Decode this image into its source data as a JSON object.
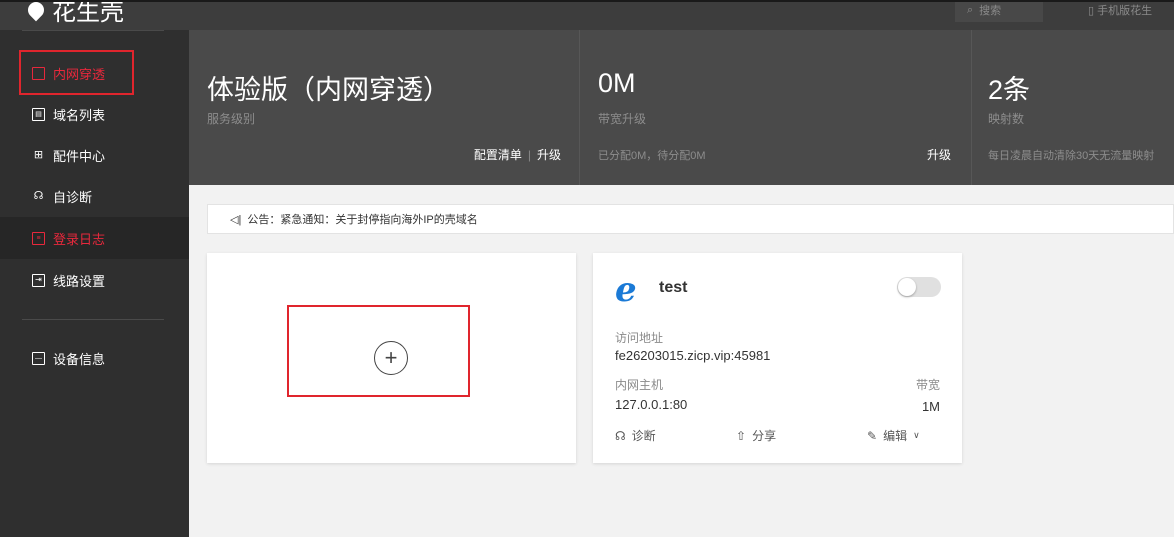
{
  "topbar": {
    "logo_text": "花生壳",
    "search_label": "搜索",
    "user_label": "手机版花生"
  },
  "sidebar": {
    "items": [
      {
        "label": "内网穿透",
        "icon": "monitor-icon"
      },
      {
        "label": "域名列表",
        "icon": "list-icon"
      },
      {
        "label": "配件中心",
        "icon": "grid-icon"
      },
      {
        "label": "自诊断",
        "icon": "diagnose-icon"
      },
      {
        "label": "登录日志",
        "icon": "log-icon"
      },
      {
        "label": "线路设置",
        "icon": "route-icon"
      },
      {
        "label": "设备信息",
        "icon": "device-icon"
      }
    ]
  },
  "stats": {
    "service": {
      "title": "体验版（内网穿透）",
      "subtitle": "服务级别",
      "action_list": "配置清单",
      "action_sep": "|",
      "action_upgrade": "升级"
    },
    "bandwidth": {
      "title": "0M",
      "subtitle": "带宽升级",
      "foot": "已分配0M，待分配0M",
      "action_upgrade": "升级"
    },
    "mappings": {
      "title": "2条",
      "subtitle": "映射数",
      "foot": "每日凌晨自动清除30天无流量映射"
    }
  },
  "notice": {
    "icon": "speaker-icon",
    "text": "公告：紧急通知：关于封停指向海外IP的壳域名"
  },
  "add_card": {
    "button_label": "+"
  },
  "tunnel_card": {
    "name": "test",
    "enabled": false,
    "access_label": "访问地址",
    "access_value": "fe26203015.zicp.vip:45981",
    "host_label": "内网主机",
    "host_value": "127.0.0.1:80",
    "bandwidth_label": "带宽",
    "bandwidth_value": "1M",
    "actions": {
      "diagnose": "诊断",
      "share": "分享",
      "edit": "编辑"
    }
  },
  "colors": {
    "accent_red": "#e8283c",
    "highlight_box": "#e0252d",
    "sidebar_bg": "#2f2f2f",
    "stats_bg": "#4a4a4a",
    "ie_blue": "#1b7ad6"
  }
}
